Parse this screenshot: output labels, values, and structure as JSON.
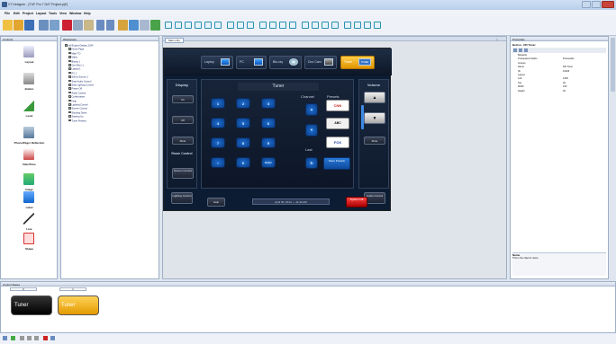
{
  "app": {
    "title": "VT Designer - [TUF Pro 7.0UT Project.pjt*]"
  },
  "menu": [
    "File",
    "Edit",
    "Project",
    "Layout",
    "Tools",
    "View",
    "Window",
    "Help"
  ],
  "panels": {
    "controls": "Controls",
    "workspace": "Workspace",
    "designer_tab": "Main (16)",
    "properties": "Properties",
    "status": "Control States"
  },
  "controls": [
    "Layout",
    "Button",
    "Level",
    "Phone/Pager Reflection",
    "Date/Time",
    "Image",
    "Label",
    "Line",
    "Shape"
  ],
  "workspace_tree": [
    "old Engine Display 1024",
    "Home Page",
    "Main TO",
    "Video",
    "Bluray 1",
    "Gen Rem 1",
    "Laptop 1",
    "PC 1",
    "Select Source 1",
    "Start Audio Control",
    "Start Lighting Control",
    "Power Off",
    "Audio Control",
    "Confirmation",
    "Help",
    "Lighting Control",
    "Screen Control",
    "Shutting Down",
    "Starting Up",
    "Tuner Presets"
  ],
  "touchpanel": {
    "sources": [
      "Laptop",
      "PC",
      "Blu-ray",
      "Doc Cam",
      "Tuner"
    ],
    "tuner_badge": "TUNER",
    "display": {
      "title": "Display",
      "buttons": [
        "On",
        "Off",
        "Mute"
      ],
      "room_control": "Room Control",
      "screen_control": "Screen Control",
      "lighting": "Lighting Control"
    },
    "center": {
      "title": "Tuner",
      "channel": "Channel",
      "presets": "Presets",
      "last": "Last",
      "keys": [
        "1",
        "2",
        "3",
        "4",
        "5",
        "6",
        "7",
        "8",
        "9",
        "",
        "0",
        "Enter"
      ],
      "more_presets": "More Presets"
    },
    "preset_logos": [
      "CNN",
      "ABC",
      "FOX"
    ],
    "volume": {
      "title": "Volume",
      "mute": "Mute",
      "audio": "Audio Control"
    },
    "bottom": {
      "help": "Help",
      "date": "April 30, 2014 — 11:42 AM",
      "system_off": "System Off"
    }
  },
  "properties": {
    "selection": "Button - DD Tuner",
    "rows": [
      {
        "k": "Behavior",
        "v": ""
      },
      {
        "k": "Transparent Radio",
        "v": "PressedAs"
      },
      {
        "k": "Groups",
        "v": ""
      },
      {
        "k": "Name",
        "v": "DD Tuner"
      },
      {
        "k": "ID",
        "v": "10023"
      },
      {
        "k": "Layout",
        "v": ""
      },
      {
        "k": "Left",
        "v": "1000"
      },
      {
        "k": "Top",
        "v": "20"
      },
      {
        "k": "Width",
        "v": "100"
      },
      {
        "k": "Height",
        "v": "40"
      }
    ],
    "desc_title": "Name",
    "desc_text": "This is the object's name."
  },
  "status_tabs": [
    "0",
    "1"
  ],
  "status_thumbs": [
    "Tuner",
    "Tuner"
  ],
  "colors": {
    "accent": "#ffb100",
    "panel_bg": "#0b1c33",
    "key_blue": "#1d6fd3"
  }
}
